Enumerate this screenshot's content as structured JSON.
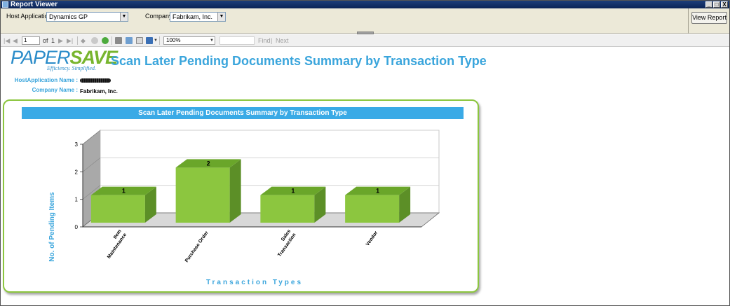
{
  "window": {
    "title": "Report Viewer",
    "controls": [
      "_",
      "□",
      "X"
    ]
  },
  "parameters": {
    "host_label": "Host Application",
    "host_value": "Dynamics GP",
    "company_label": "Company",
    "company_value": "Fabrikam, Inc.",
    "view_button": "View Report"
  },
  "toolbar": {
    "page_current": "1",
    "page_of": "of",
    "page_total": "1",
    "zoom": "100%",
    "find": "Find",
    "next": "Next",
    "separator": "|"
  },
  "report": {
    "logo_paper": "PAPER",
    "logo_save": "SAVE",
    "logo_tagline": "Efficiency. Simplified.",
    "title": "Scan Later Pending Documents Summary by Transaction Type",
    "host_name_label": "HostApplication Name :",
    "company_name_label": "Company Name :",
    "company_name_value": "Fabrikam, Inc."
  },
  "chart_data": {
    "type": "bar",
    "title": "Scan Later Pending Documents Summary by Transaction Type",
    "categories": [
      [
        "Item",
        "Maintenance"
      ],
      [
        "Purchase Order"
      ],
      [
        "Sales",
        "Transaction"
      ],
      [
        "Vendor"
      ]
    ],
    "values": [
      1,
      2,
      1,
      1
    ],
    "xlabel": "Transaction Types",
    "ylabel": "No. of Pending Items",
    "ylim": [
      0,
      3
    ],
    "yticks": [
      0,
      1,
      2,
      3
    ],
    "grid": true,
    "style": "3d",
    "colors": {
      "bar": "#8cc63f",
      "bar_top": "#6aa62a",
      "bar_side": "#5c8f27",
      "axis_label": "#3aa5dc"
    }
  }
}
